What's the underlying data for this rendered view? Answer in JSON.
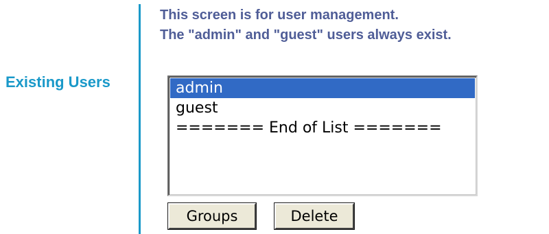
{
  "intro": {
    "line1": "This screen is for user management.",
    "line2": "The \"admin\" and \"guest\" users always exist."
  },
  "section": {
    "label": "Existing Users"
  },
  "users_list": {
    "options": [
      "admin",
      "guest",
      "======= End of List ======="
    ],
    "selected": "admin"
  },
  "buttons": {
    "groups_label": "Groups",
    "delete_label": "Delete"
  },
  "colors": {
    "accent": "#1a99c9",
    "heading_text": "#4f5d97",
    "selection": "#316ac5"
  }
}
